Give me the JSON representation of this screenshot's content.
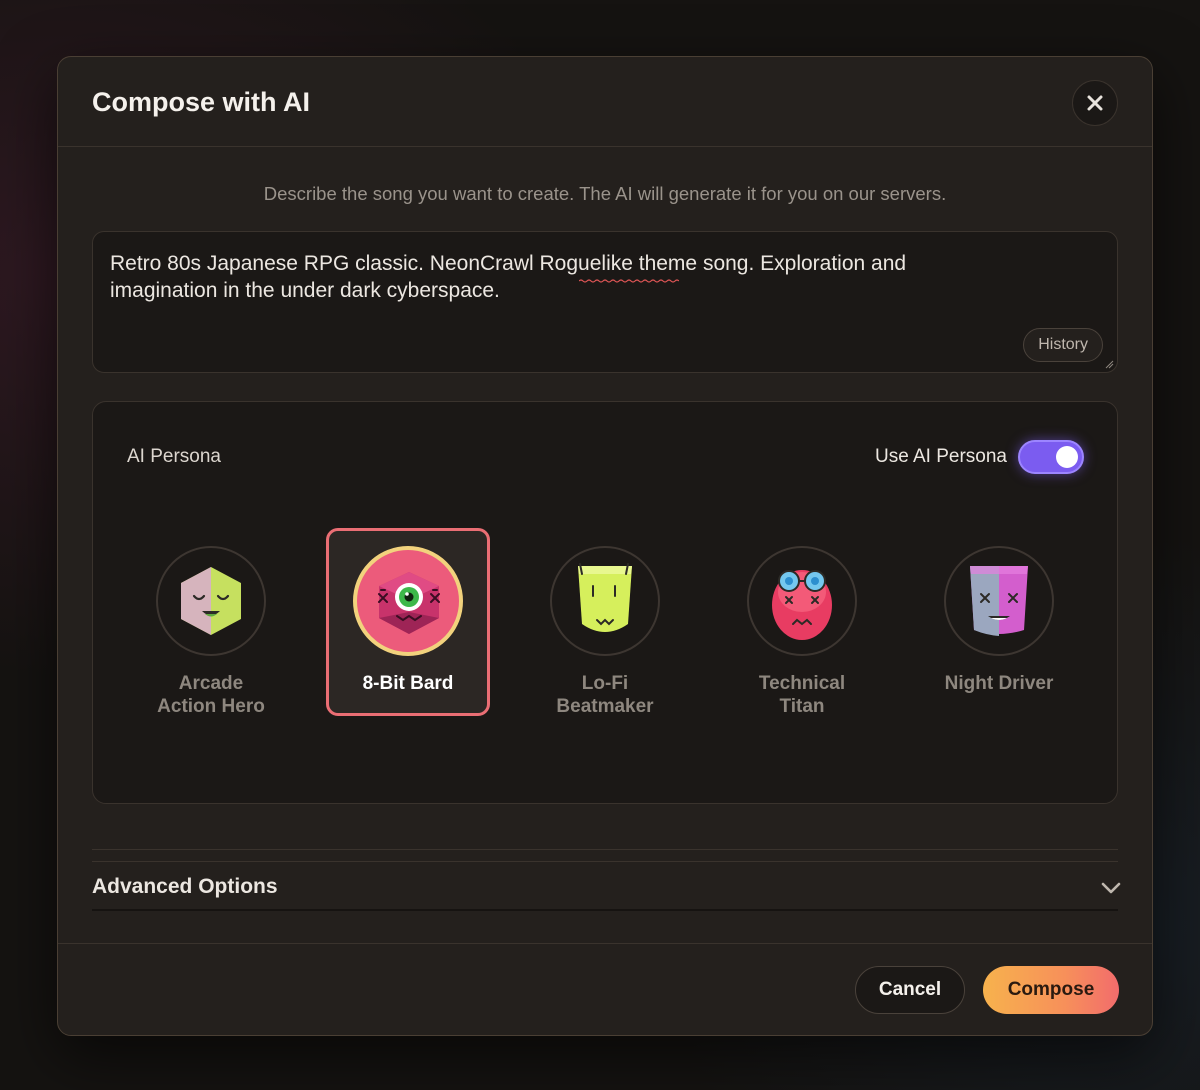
{
  "modal": {
    "title": "Compose with AI",
    "subtitle": "Describe the song you want to create. The AI will generate it for you on our servers."
  },
  "prompt": {
    "value": "Retro 80s Japanese RPG classic. NeonCrawl Roguelike theme song. Exploration and\nimagination in the under dark cyberspace.",
    "history_label": "History"
  },
  "persona_section": {
    "label": "AI Persona",
    "toggle_label": "Use AI Persona",
    "toggle_on": true,
    "selected": "8-Bit Bard",
    "items": [
      {
        "name": "Arcade\nAction Hero",
        "icon": "sleepy-hexagon-face-icon"
      },
      {
        "name": "8-Bit Bard",
        "icon": "cyclops-gem-face-icon"
      },
      {
        "name": "Lo-Fi\nBeatmaker",
        "icon": "lime-cup-face-icon"
      },
      {
        "name": "Technical\nTitan",
        "icon": "goggles-egg-face-icon"
      },
      {
        "name": "Night Driver",
        "icon": "split-cup-face-icon"
      }
    ]
  },
  "advanced": {
    "label": "Advanced Options"
  },
  "footer": {
    "cancel_label": "Cancel",
    "compose_label": "Compose"
  },
  "colors": {
    "accent_toggle": "#7b5cf0",
    "selected_border": "#ea6e74",
    "compose_gradient_start": "#f7b24d",
    "compose_gradient_end": "#f26c6c"
  }
}
